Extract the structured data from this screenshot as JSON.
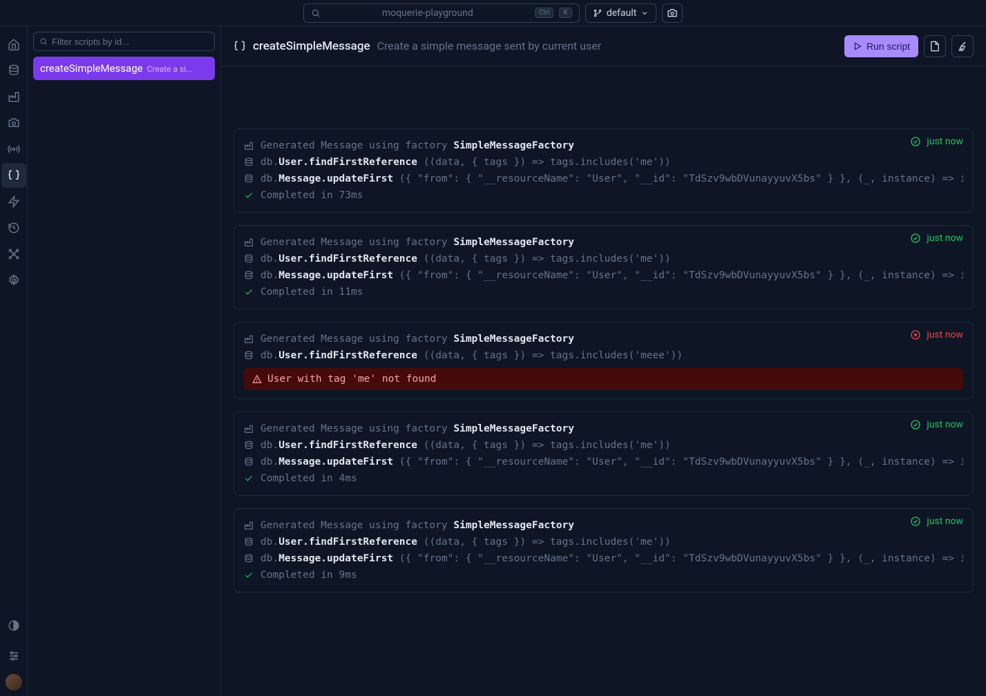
{
  "topbar": {
    "search_text": "moquerie-playground",
    "kbd1": "Ctrl",
    "kbd2": "K",
    "branch_label": "default"
  },
  "filter": {
    "placeholder": "Filter scripts by id..."
  },
  "script_list": [
    {
      "name": "createSimpleMessage",
      "desc": "Create a si..."
    }
  ],
  "header": {
    "title": "createSimpleMessage",
    "desc": "Create a simple message sent by current user",
    "run_label": "Run script"
  },
  "logs": [
    {
      "status": "success",
      "time": "just now",
      "lines": [
        {
          "icon": "factory",
          "prefix": "Generated Message using factory ",
          "bold": "SimpleMessageFactory",
          "args": ""
        },
        {
          "icon": "db",
          "prefix": "db.",
          "bold": "User.findFirstReference",
          "args": " ((data, { tags }) => tags.includes('me'))"
        },
        {
          "icon": "db",
          "prefix": "db.",
          "bold": "Message.updateFirst",
          "args": " ({ \"from\": { \"__resourceName\": \"User\", \"__id\": \"TdSzv9wbDVunayyuvX5bs\" } }, (_, instance) => inst…"
        }
      ],
      "completed": "Completed in 73ms"
    },
    {
      "status": "success",
      "time": "just now",
      "lines": [
        {
          "icon": "factory",
          "prefix": "Generated Message using factory ",
          "bold": "SimpleMessageFactory",
          "args": ""
        },
        {
          "icon": "db",
          "prefix": "db.",
          "bold": "User.findFirstReference",
          "args": " ((data, { tags }) => tags.includes('me'))"
        },
        {
          "icon": "db",
          "prefix": "db.",
          "bold": "Message.updateFirst",
          "args": " ({ \"from\": { \"__resourceName\": \"User\", \"__id\": \"TdSzv9wbDVunayyuvX5bs\" } }, (_, instance) => inst…"
        }
      ],
      "completed": "Completed in 11ms"
    },
    {
      "status": "error",
      "time": "just now",
      "lines": [
        {
          "icon": "factory",
          "prefix": "Generated Message using factory ",
          "bold": "SimpleMessageFactory",
          "args": ""
        },
        {
          "icon": "db",
          "prefix": "db.",
          "bold": "User.findFirstReference",
          "args": " ((data, { tags }) => tags.includes('meee'))"
        }
      ],
      "error": "User with tag 'me' not found"
    },
    {
      "status": "success",
      "time": "just now",
      "lines": [
        {
          "icon": "factory",
          "prefix": "Generated Message using factory ",
          "bold": "SimpleMessageFactory",
          "args": ""
        },
        {
          "icon": "db",
          "prefix": "db.",
          "bold": "User.findFirstReference",
          "args": " ((data, { tags }) => tags.includes('me'))"
        },
        {
          "icon": "db",
          "prefix": "db.",
          "bold": "Message.updateFirst",
          "args": " ({ \"from\": { \"__resourceName\": \"User\", \"__id\": \"TdSzv9wbDVunayyuvX5bs\" } }, (_, instance) => inst…"
        }
      ],
      "completed": "Completed in 4ms"
    },
    {
      "status": "success",
      "time": "just now",
      "lines": [
        {
          "icon": "factory",
          "prefix": "Generated Message using factory ",
          "bold": "SimpleMessageFactory",
          "args": ""
        },
        {
          "icon": "db",
          "prefix": "db.",
          "bold": "User.findFirstReference",
          "args": " ((data, { tags }) => tags.includes('me'))"
        },
        {
          "icon": "db",
          "prefix": "db.",
          "bold": "Message.updateFirst",
          "args": " ({ \"from\": { \"__resourceName\": \"User\", \"__id\": \"TdSzv9wbDVunayyuvX5bs\" } }, (_, instance) => inst…"
        }
      ],
      "completed": "Completed in 9ms"
    }
  ]
}
